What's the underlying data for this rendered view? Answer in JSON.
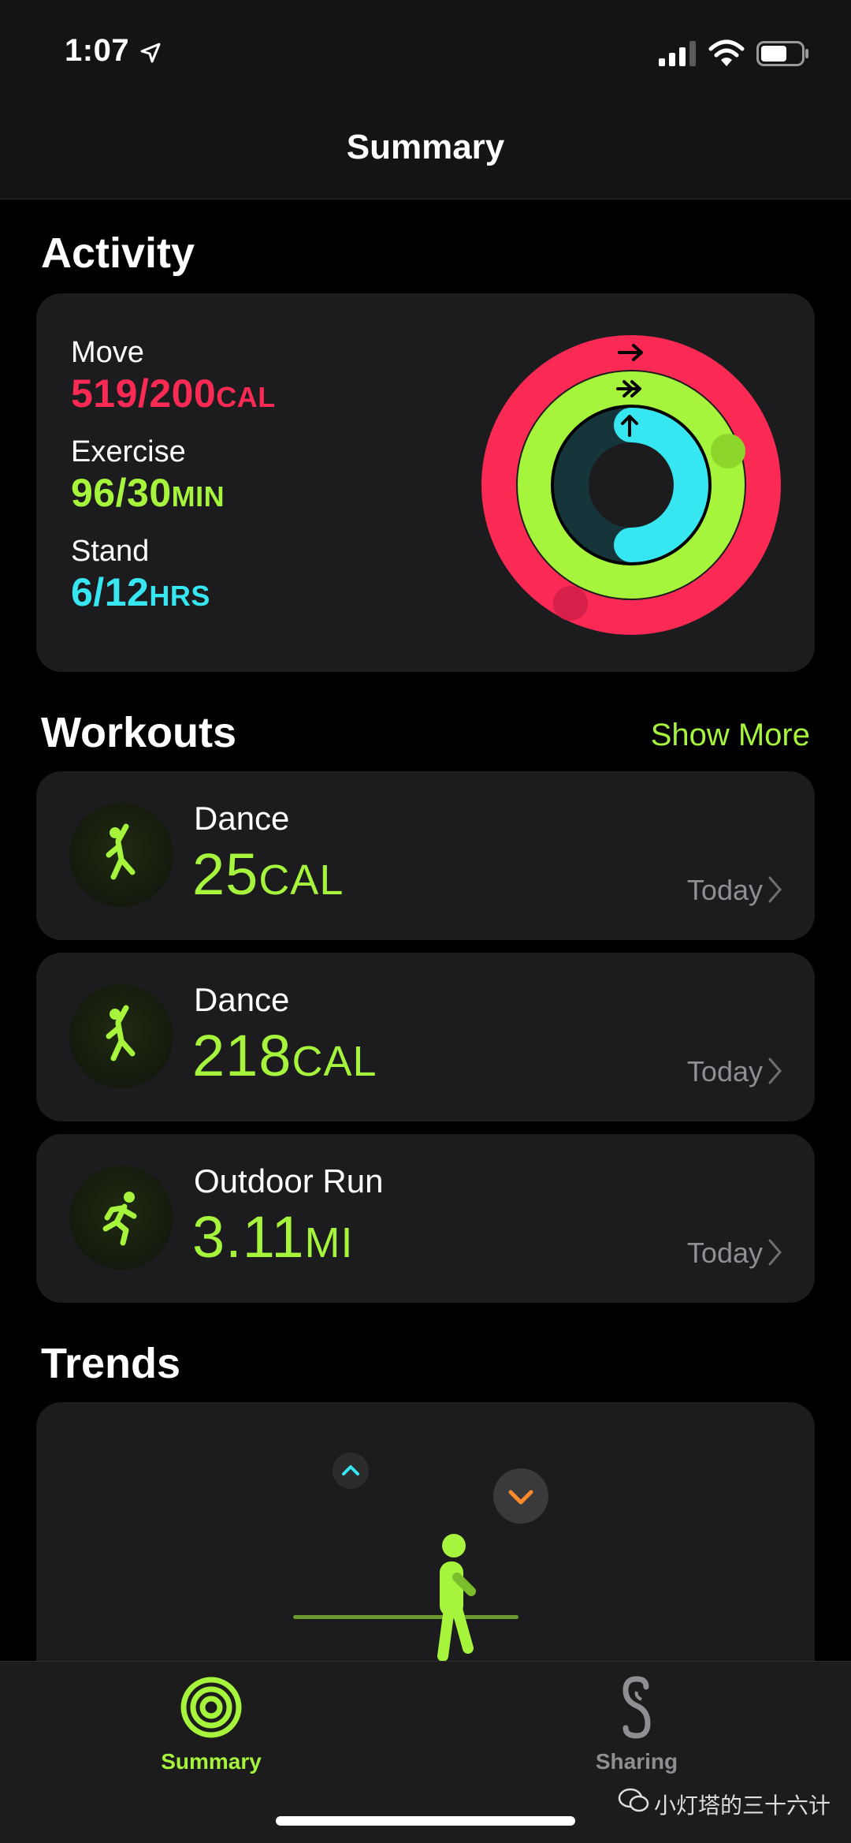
{
  "status_bar": {
    "time": "1:07"
  },
  "nav": {
    "title": "Summary"
  },
  "activity": {
    "title": "Activity",
    "move": {
      "label": "Move",
      "value": "519/200",
      "unit": "CAL",
      "progress": 2.595,
      "color": "#fa2a55"
    },
    "exercise": {
      "label": "Exercise",
      "value": "96/30",
      "unit": "MIN",
      "progress": 3.2,
      "color": "#a6f43c"
    },
    "stand": {
      "label": "Stand",
      "value": "6/12",
      "unit": "HRS",
      "progress": 0.5,
      "color": "#36e6f0"
    }
  },
  "workouts": {
    "title": "Workouts",
    "show_more": "Show More",
    "items": [
      {
        "name": "Dance",
        "value": "25",
        "unit": "CAL",
        "date": "Today",
        "icon": "dance-icon"
      },
      {
        "name": "Dance",
        "value": "218",
        "unit": "CAL",
        "date": "Today",
        "icon": "dance-icon"
      },
      {
        "name": "Outdoor Run",
        "value": "3.11",
        "unit": "MI",
        "date": "Today",
        "icon": "run-icon"
      }
    ]
  },
  "trends": {
    "title": "Trends"
  },
  "tabbar": {
    "summary": {
      "label": "Summary",
      "color": "#a6f43c"
    },
    "sharing": {
      "label": "Sharing",
      "color": "#8e8e93"
    }
  },
  "watermark": {
    "text": "小灯塔的三十六计"
  }
}
